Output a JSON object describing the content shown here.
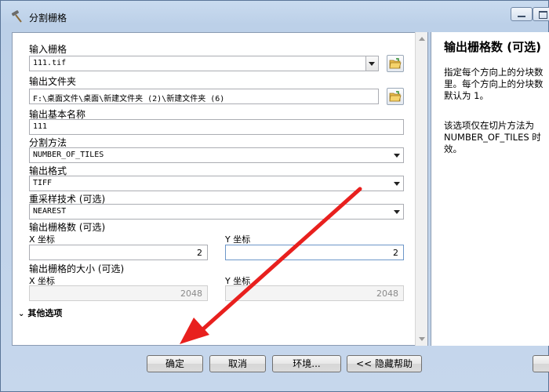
{
  "window": {
    "title": "分割栅格"
  },
  "form": {
    "input_raster": {
      "label": "输入栅格",
      "value": "111.tif"
    },
    "output_folder": {
      "label": "输出文件夹",
      "value": "F:\\桌面文件\\桌面\\新建文件夹 (2)\\新建文件夹 (6)"
    },
    "output_base_name": {
      "label": "输出基本名称",
      "value": "111"
    },
    "split_method": {
      "label": "分割方法",
      "value": "NUMBER_OF_TILES"
    },
    "output_format": {
      "label": "输出格式",
      "value": "TIFF"
    },
    "resampling": {
      "label": "重采样技术 (可选)",
      "value": "NEAREST"
    },
    "num_rasters": {
      "label": "输出栅格数 (可选)",
      "x_label": "X 坐标",
      "x_value": "2",
      "y_label": "Y 坐标",
      "y_value": "2"
    },
    "cell_size": {
      "label": "输出栅格的大小 (可选)",
      "x_label": "X 坐标",
      "x_value": "2048",
      "y_label": "Y 坐标",
      "y_value": "2048"
    },
    "other_options": "其他选项"
  },
  "help": {
    "title": "输出栅格数 (可选)",
    "para1": [
      "指定每个方向上的分块数",
      "里。每个方向上的分块数",
      "默认为 1。"
    ],
    "para2": [
      "该选项仅在切片方法为",
      "NUMBER_OF_TILES 时",
      "效。"
    ]
  },
  "buttons": {
    "ok": "确定",
    "cancel": "取消",
    "env": "环境...",
    "hide_help": "<< 隐藏帮助"
  },
  "colors": {
    "annotation_arrow": "#e8201e",
    "titlebar": "#c9dbef"
  }
}
